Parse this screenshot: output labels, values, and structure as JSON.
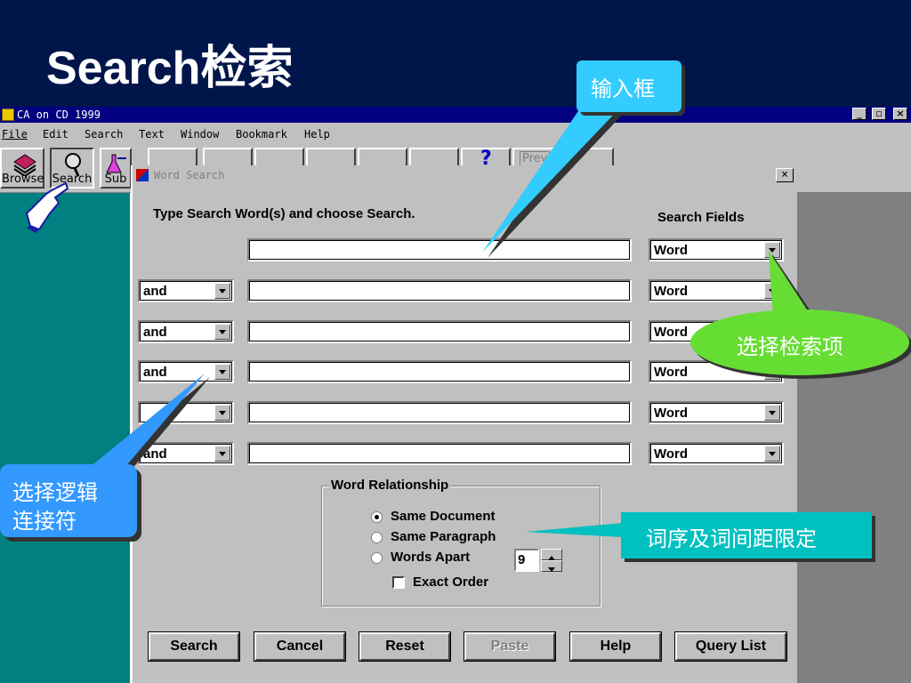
{
  "slide": {
    "title_latin": "Search",
    "title_cjk": "检索"
  },
  "app": {
    "window_title": "CA on CD 1999",
    "window_buttons": [
      "_",
      "▫",
      "×"
    ],
    "menu": [
      "File",
      "Edit",
      "Search",
      "Text",
      "Window",
      "Bookmark",
      "Help"
    ],
    "toolbar": [
      {
        "label": "Browse",
        "icon": "books-icon"
      },
      {
        "label": "Search",
        "icon": "magnifier-icon"
      },
      {
        "label": "Sub",
        "icon": "flask-icon"
      }
    ],
    "prev_label": "Prev"
  },
  "dialog": {
    "title": "Word Search",
    "close": "×",
    "instruction": "Type Search Word(s) and choose Search.",
    "fields_header": "Search Fields",
    "rows": [
      {
        "operator": "",
        "term": "",
        "field": "Word"
      },
      {
        "operator": "and",
        "term": "",
        "field": "Word"
      },
      {
        "operator": "and",
        "term": "",
        "field": "Word"
      },
      {
        "operator": "and",
        "term": "",
        "field": "Word"
      },
      {
        "operator": "",
        "term": "",
        "field": "Word"
      },
      {
        "operator": "and",
        "term": "",
        "field": "Word"
      }
    ],
    "relationship": {
      "title": "Word Relationship",
      "options": [
        "Same Document",
        "Same Paragraph",
        "Words Apart"
      ],
      "selected": "Same Document",
      "words_apart_value": "9",
      "exact_order_label": "Exact Order",
      "exact_order_checked": false
    },
    "buttons": {
      "search": "Search",
      "cancel": "Cancel",
      "reset": "Reset",
      "paste": "Paste",
      "help": "Help",
      "query_list": "Query List"
    }
  },
  "callouts": {
    "input_box": "输入框",
    "select_field": "选择检索项",
    "select_operator_1": "选择逻辑",
    "select_operator_2": "连接符",
    "word_relation": "词序及词间距限定"
  },
  "colors": {
    "slide_bg": "#00164a",
    "titlebar": "#000080",
    "callout_cyan": "#33ccff",
    "callout_green": "#66dd33",
    "callout_blue": "#3399ff",
    "callout_teal": "#00c0c0"
  }
}
